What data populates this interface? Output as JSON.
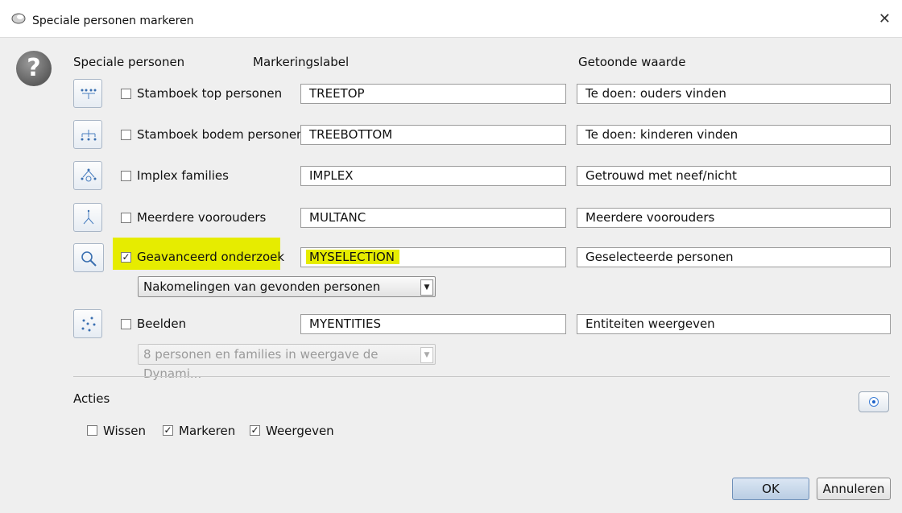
{
  "window": {
    "title": "Speciale personen markeren"
  },
  "headers": {
    "special": "Speciale personen",
    "label": "Markeringslabel",
    "value": "Getoonde waarde"
  },
  "rows": [
    {
      "label": "Stamboek top personen",
      "checked": false,
      "marker": "TREETOP",
      "display": "Te doen: ouders vinden",
      "icon": "tree-top-icon"
    },
    {
      "label": "Stamboek bodem personen",
      "checked": false,
      "marker": "TREEBOTTOM",
      "display": "Te doen: kinderen vinden",
      "icon": "tree-bottom-icon"
    },
    {
      "label": "Implex families",
      "checked": false,
      "marker": "IMPLEX",
      "display": "Getrouwd met neef/nicht",
      "icon": "implex-icon"
    },
    {
      "label": "Meerdere voorouders",
      "checked": false,
      "marker": "MULTANC",
      "display": "Meerdere voorouders",
      "icon": "multiple-ancestors-icon"
    },
    {
      "label": "Geavanceerd onderzoek",
      "checked": true,
      "marker": "MYSELECTION",
      "display": "Geselecteerde personen",
      "icon": "search-icon"
    },
    {
      "label": "Beelden",
      "checked": false,
      "marker": "MYENTITIES",
      "display": "Entiteiten weergeven",
      "icon": "views-icon"
    }
  ],
  "search_combo": {
    "selected": "Nakomelingen van gevonden personen"
  },
  "views_combo": {
    "selected": "8 personen en families in weergave de Dynami..."
  },
  "actions": {
    "title": "Acties",
    "items": [
      {
        "label": "Wissen",
        "checked": false
      },
      {
        "label": "Markeren",
        "checked": true
      },
      {
        "label": "Weergeven",
        "checked": true
      }
    ]
  },
  "buttons": {
    "ok": "OK",
    "cancel": "Annuleren"
  },
  "colors": {
    "highlight": "#e6ec00",
    "accent": "#1e63c9"
  }
}
